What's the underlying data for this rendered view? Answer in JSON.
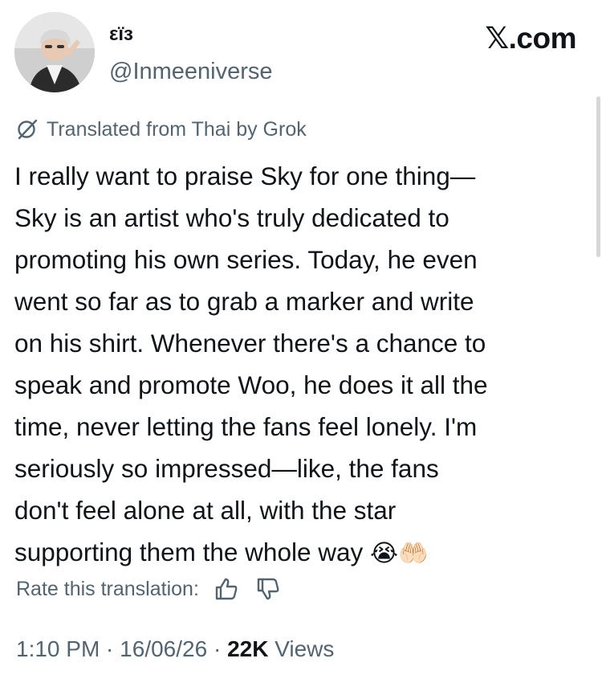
{
  "author": {
    "display_name": "εïз",
    "handle": "@Inmeeniverse",
    "avatar_icon": "profile-photo"
  },
  "brand": "𝕏.com",
  "translation_note": "Translated from Thai by Grok",
  "tweet_lines": [
    "I really want to praise Sky for one thing—",
    "Sky is an artist who's truly dedicated to",
    "promoting his own series. Today, he even",
    "went so far as to grab a marker and write",
    "on his shirt. Whenever there's a chance to",
    "speak and promote Woo, he does it all the",
    "time, never letting the fans feel lonely. I'm",
    "seriously so impressed—like, the fans",
    "don't feel alone at all, with the star",
    "supporting them the whole way"
  ],
  "tweet_emojis": [
    "😭",
    "🤲🏻"
  ],
  "rate": {
    "label": "Rate this translation:",
    "thumbs_up_icon": "thumbs-up-icon",
    "thumbs_down_icon": "thumbs-down-icon"
  },
  "meta": {
    "time": "1:10 PM",
    "sep1": " · ",
    "date": "16/06/26",
    "sep2": " · ",
    "views_count": "22K",
    "views_label": " Views"
  },
  "colors": {
    "text": "#0f1419",
    "secondary": "#536471",
    "background": "#ffffff"
  }
}
